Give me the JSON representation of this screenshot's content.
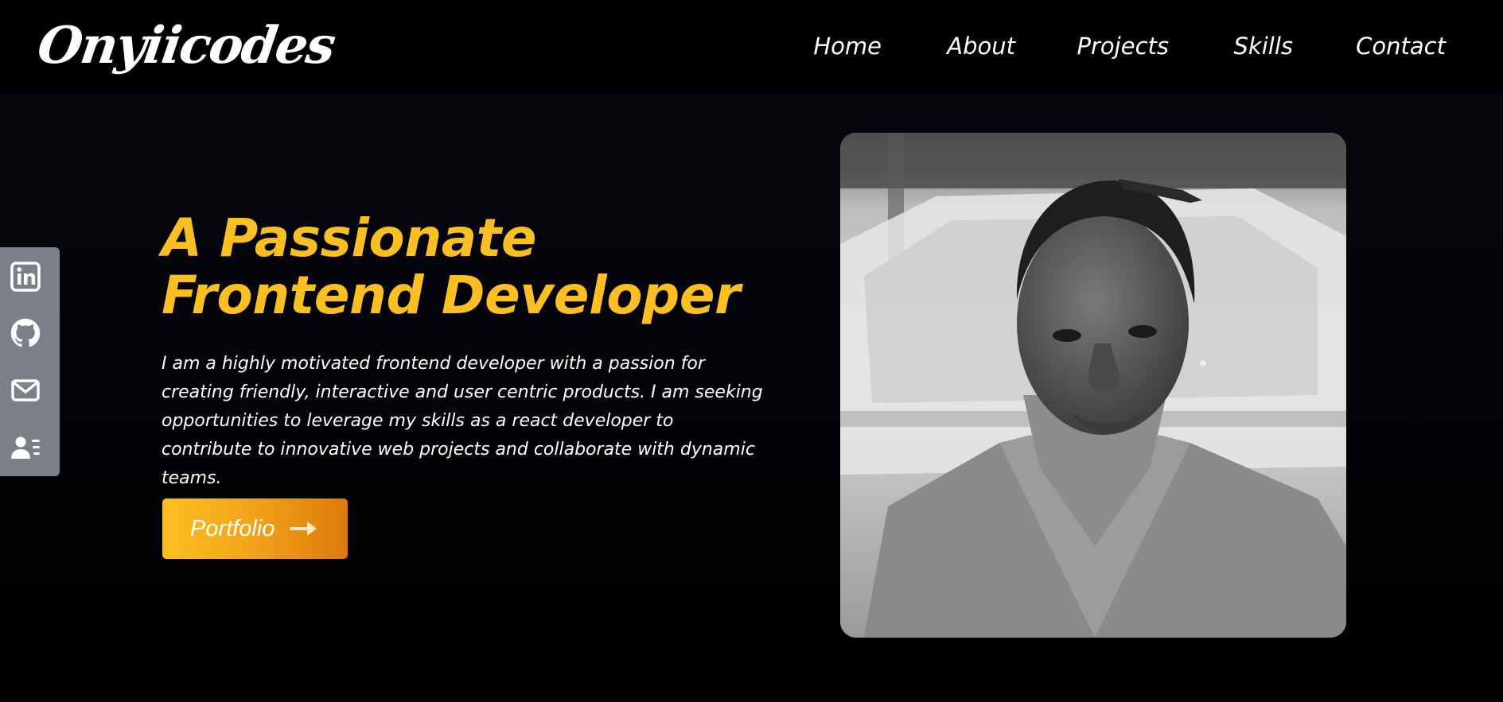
{
  "logo": {
    "text": "Onyiicodes"
  },
  "nav": {
    "items": [
      {
        "label": "Home"
      },
      {
        "label": "About"
      },
      {
        "label": "Projects"
      },
      {
        "label": "Skills"
      },
      {
        "label": "Contact"
      }
    ]
  },
  "social": {
    "icons": [
      "linkedin-icon",
      "github-icon",
      "mail-icon",
      "contact-card-icon"
    ]
  },
  "hero": {
    "headline": "A Passionate Frontend Developer",
    "bio": "I am a highly motivated frontend developer with a passion for creating friendly, interactive and user centric products. I am seeking opportunities to leverage my skills as a react developer to contribute to innovative web projects and collaborate with dynamic teams.",
    "cta_label": "Portfolio",
    "cta_icon": "arrow-right-icon"
  },
  "colors": {
    "accent": "#fbbf24",
    "accent_dark": "#dd7a0b",
    "nav_background": "#000000",
    "page_background": "#03050a",
    "sidebar_background": "#7b7f89",
    "text": "#ffffff"
  }
}
